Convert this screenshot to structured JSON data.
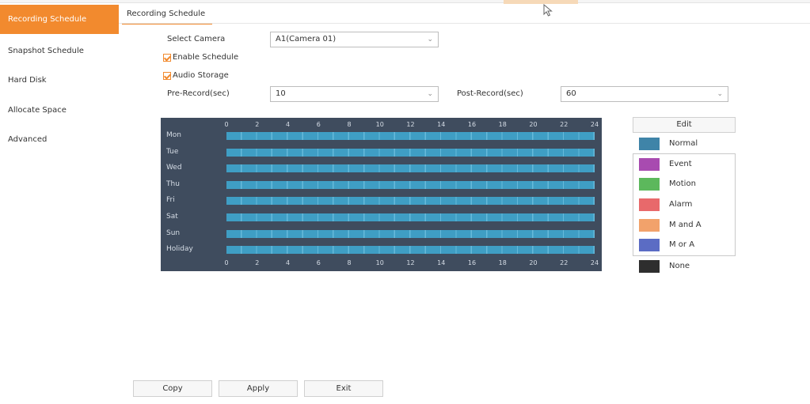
{
  "sidebar": {
    "items": [
      {
        "label": "Recording Schedule",
        "active": true
      },
      {
        "label": "Snapshot Schedule",
        "active": false
      },
      {
        "label": "Hard Disk",
        "active": false
      },
      {
        "label": "Allocate Space",
        "active": false
      },
      {
        "label": "Advanced",
        "active": false
      }
    ]
  },
  "tabs": [
    {
      "label": "Recording Schedule"
    }
  ],
  "form": {
    "select_camera_label": "Select Camera",
    "camera_value": "A1(Camera 01)",
    "enable_schedule_label": "Enable Schedule",
    "enable_schedule_checked": true,
    "audio_storage_label": "Audio Storage",
    "audio_storage_checked": true,
    "pre_record_label": "Pre-Record(sec)",
    "pre_record_value": "10",
    "post_record_label": "Post-Record(sec)",
    "post_record_value": "60"
  },
  "schedule": {
    "hour_labels": [
      "0",
      "2",
      "4",
      "6",
      "8",
      "10",
      "12",
      "14",
      "16",
      "18",
      "20",
      "22",
      "24"
    ],
    "days": [
      "Mon",
      "Tue",
      "Wed",
      "Thu",
      "Fri",
      "Sat",
      "Sun",
      "Holiday"
    ],
    "fill_type": "Normal",
    "fill_color": "#3f9ec4",
    "panel_color": "#3f4c5e"
  },
  "legend": {
    "edit_label": "Edit",
    "items": [
      {
        "label": "Normal",
        "color": "#3f84a8"
      },
      {
        "label": "Event",
        "color": "#a84bb0"
      },
      {
        "label": "Motion",
        "color": "#5cb85c"
      },
      {
        "label": "Alarm",
        "color": "#e8696b"
      },
      {
        "label": "M and A",
        "color": "#f2a26b"
      },
      {
        "label": "M or A",
        "color": "#5b6cc4"
      },
      {
        "label": "None",
        "color": "#2e2e2e"
      }
    ]
  },
  "buttons": {
    "copy": "Copy",
    "apply": "Apply",
    "exit": "Exit"
  },
  "colors": {
    "accent": "#f28a2e"
  },
  "icons": {
    "dropdown": "chevron-down-icon",
    "cursor": "mouse-pointer-icon",
    "checkbox": "checkbox-checked-icon"
  }
}
